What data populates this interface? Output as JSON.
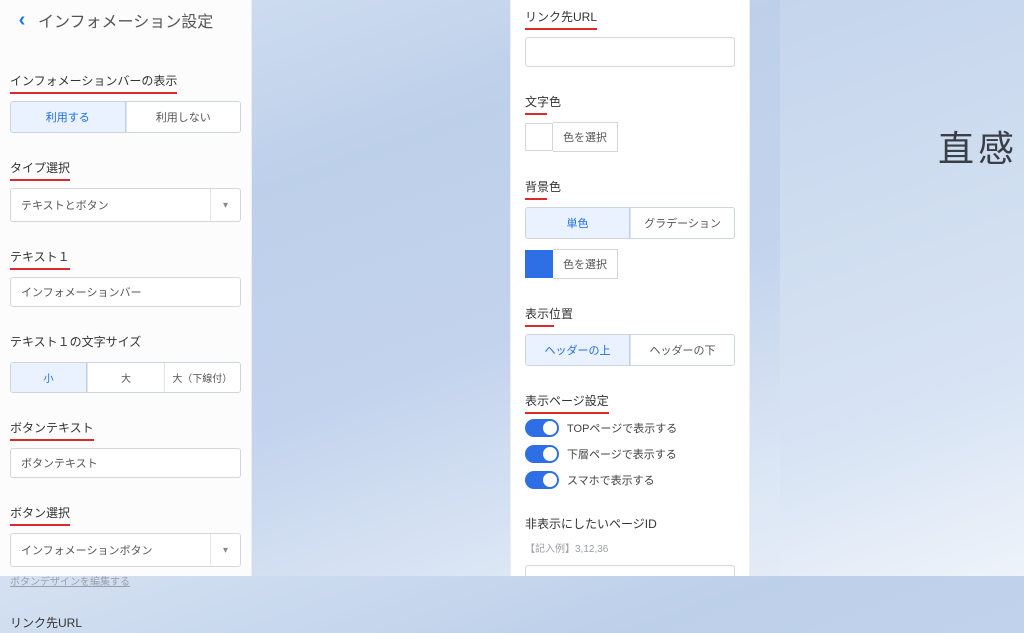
{
  "left": {
    "header_title": "インフォメーション設定",
    "s_display_label": "インフォメーションバーの表示",
    "display_opts": {
      "on": "利用する",
      "off": "利用しない"
    },
    "s_type_label": "タイプ選択",
    "type_selected": "テキストとボタン",
    "s_text1_label": "テキスト１",
    "text1_value": "インフォメーションバー",
    "s_text1size_label": "テキスト１の文字サイズ",
    "size_opts": {
      "sm": "小",
      "md": "大",
      "mdU": "大（下線付）"
    },
    "s_btntext_label": "ボタンテキスト",
    "btntext_value": "ボタンテキスト",
    "s_btnsel_label": "ボタン選択",
    "btnsel_value": "インフォメーションボタン",
    "btn_edit_link": "ボタンデザインを編集する",
    "s_linkurl_label": "リンク先URL"
  },
  "middle": {
    "s_linkurl_label": "リンク先URL",
    "linkurl_value": "",
    "s_textcolor_label": "文字色",
    "pick_color": "色を選択",
    "s_bgcolor_label": "背景色",
    "bg_opts": {
      "solid": "単色",
      "grad": "グラデーション"
    },
    "s_position_label": "表示位置",
    "pos_opts": {
      "above": "ヘッダーの上",
      "below": "ヘッダーの下"
    },
    "s_pageset_label": "表示ページ設定",
    "toggle_top": "TOPページで表示する",
    "toggle_sub": "下層ページで表示する",
    "toggle_sp": "スマホで表示する",
    "s_hide_label": "非表示にしたいページID",
    "hide_example": "【記入例】3,12,36",
    "hide_value": ""
  },
  "right": {
    "hero_text": "直感"
  }
}
